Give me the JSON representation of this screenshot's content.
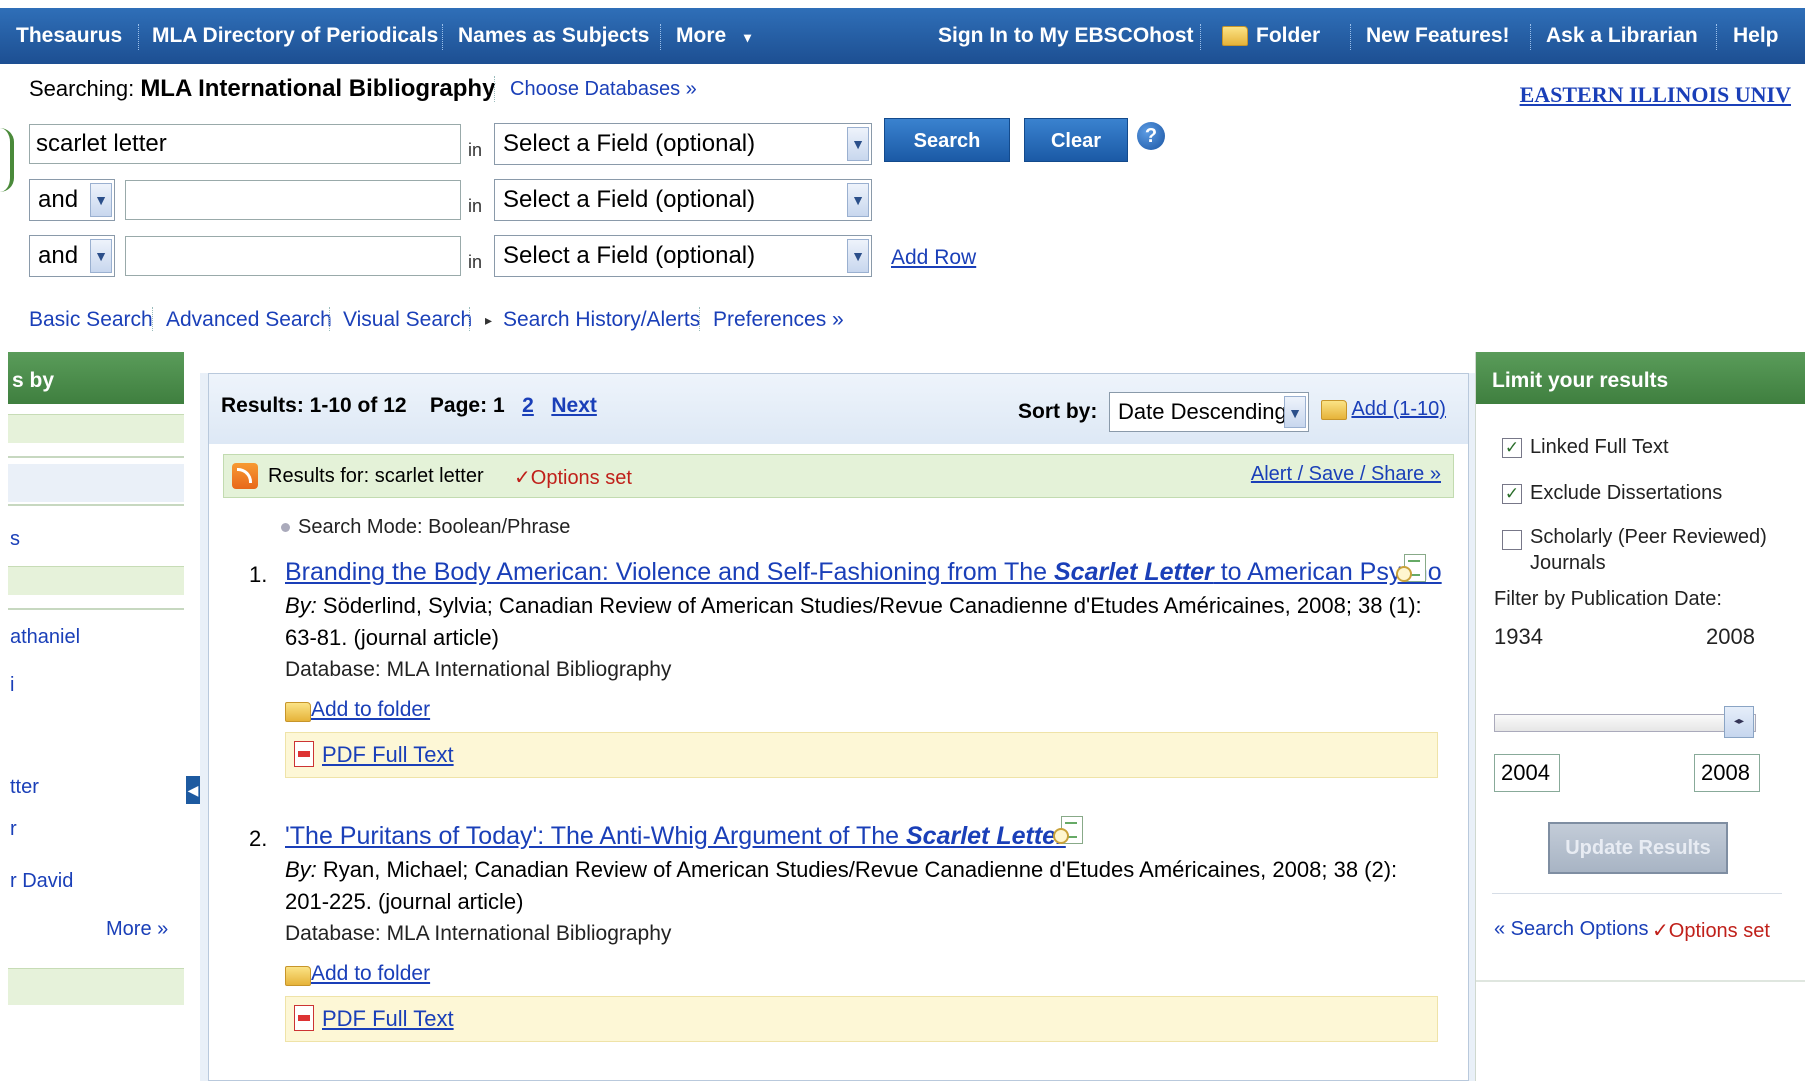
{
  "topnav": {
    "items": [
      "Thesaurus",
      "MLA Directory of Periodicals",
      "Names as Subjects",
      "More"
    ],
    "more_arrow": "▾",
    "signin": "Sign In to My EBSCOhost",
    "folder": "Folder",
    "new_features": "New Features!",
    "ask_librarian": "Ask a Librarian",
    "help": "Help"
  },
  "search": {
    "searching_label": "Searching:",
    "database": "MLA International Bibliography",
    "choose_databases": "Choose Databases »",
    "institution": "EASTERN ILLINOIS UNIV",
    "rows": [
      {
        "bool": "",
        "term": "scarlet letter",
        "in": "in",
        "field": "Select a Field (optional)"
      },
      {
        "bool": "and",
        "term": "",
        "in": "in",
        "field": "Select a Field (optional)"
      },
      {
        "bool": "and",
        "term": "",
        "in": "in",
        "field": "Select a Field (optional)"
      }
    ],
    "search_button": "Search",
    "clear_button": "Clear",
    "help_icon": "?",
    "add_row": "Add Row"
  },
  "subnav": {
    "items": [
      "Basic Search",
      "Advanced Search",
      "Visual Search",
      "Search History/Alerts",
      "Preferences »"
    ],
    "history_arrow": "▸"
  },
  "left": {
    "header": "s by",
    "texts": [
      "s",
      "athaniel",
      "i",
      "tter",
      "r",
      "r David"
    ],
    "more": "More »"
  },
  "results": {
    "count": "Results: 1-10 of 12",
    "page_label": "Page: 1",
    "page_2": "2",
    "next": "Next",
    "sort_label": "Sort by:",
    "sort_value": "Date Descending",
    "add_range": "Add (1-10)",
    "results_for_label": "Results for:",
    "results_for_query": "scarlet letter",
    "options_set": "✓Options set",
    "alert_save_share": "Alert / Save / Share »",
    "search_mode": "Search Mode: Boolean/Phrase",
    "items": [
      {
        "num": "1.",
        "title_pre": "Branding the Body American: Violence and Self-Fashioning from The ",
        "title_em": "Scarlet Letter",
        "title_post": " to American Psycho",
        "by_label": "By:",
        "by_text": " Söderlind, Sylvia; Canadian Review of American Studies/Revue Canadienne d'Etudes Américaines, 2008; 38 (1): 63-81. (journal article)",
        "database": "Database: MLA International Bibliography",
        "add_to_folder": "Add to folder",
        "pdf": "PDF Full Text"
      },
      {
        "num": "2.",
        "title_pre": "'The Puritans of Today': The Anti-Whig Argument of The ",
        "title_em": "Scarlet Letter",
        "title_post": "",
        "by_label": "By:",
        "by_text": " Ryan, Michael; Canadian Review of American Studies/Revue Canadienne d'Etudes Américaines, 2008; 38 (2): 201-225. (journal article)",
        "database": "Database: MLA International Bibliography",
        "add_to_folder": "Add to folder",
        "pdf": "PDF Full Text"
      }
    ]
  },
  "limits": {
    "header": "Limit your results",
    "checkboxes": [
      {
        "label": "Linked Full Text",
        "checked": true
      },
      {
        "label": "Exclude Dissertations",
        "checked": true
      },
      {
        "label": "Scholarly (Peer Reviewed)",
        "label2": "Journals",
        "checked": false
      }
    ],
    "check_mark": "✓",
    "filter_label": "Filter by Publication Date:",
    "range_min": "1934",
    "range_max": "2008",
    "date_from": "2004",
    "date_to": "2008",
    "slider_level": 1.0,
    "update_button": "Update Results",
    "search_options": "« Search Options",
    "options_set": "✓Options set"
  },
  "colors": {
    "nav_blue": "#1d4f92",
    "green_header": "#3f7f3f",
    "link_blue": "#1a3fb8",
    "options_red": "#c0201a"
  }
}
